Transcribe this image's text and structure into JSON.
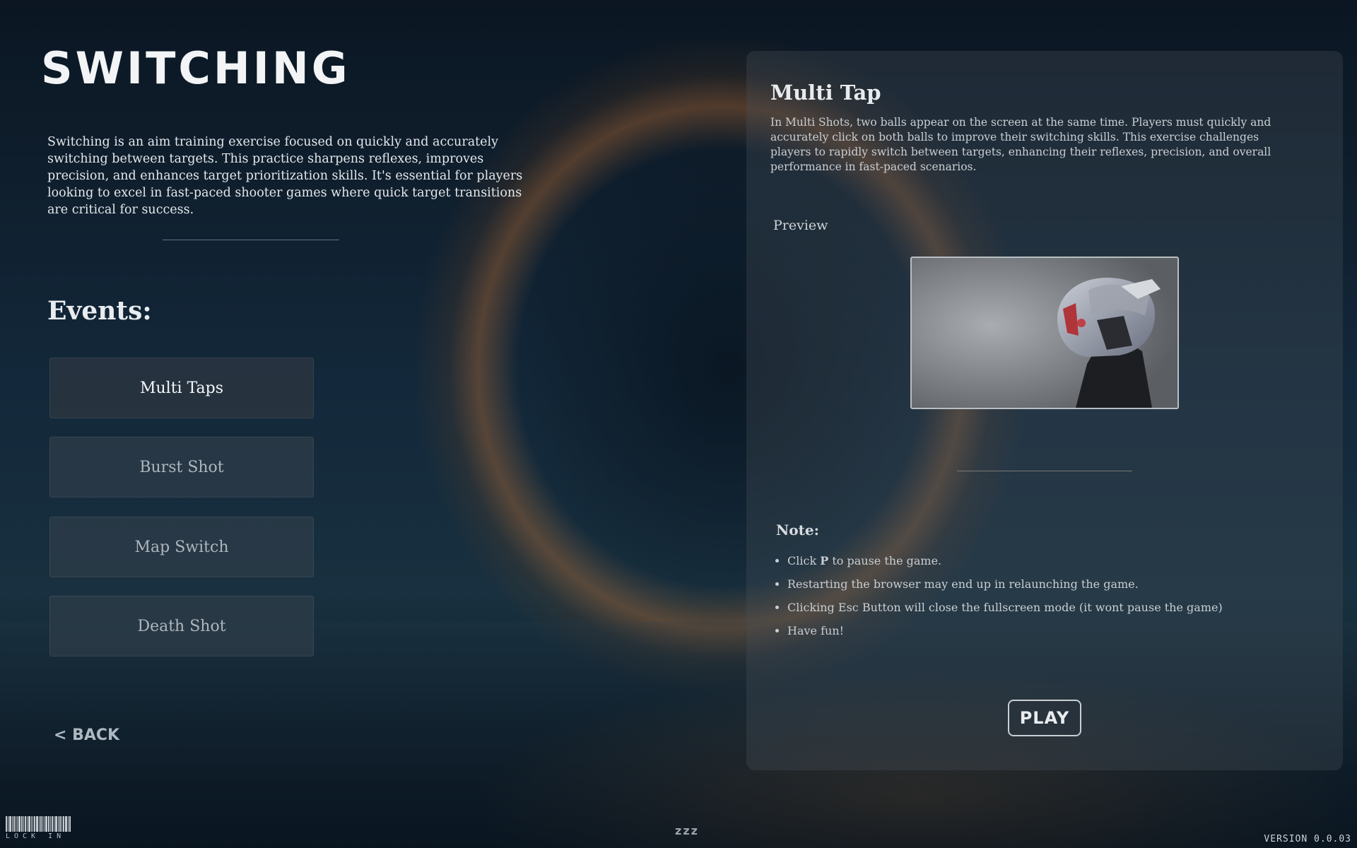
{
  "header": {
    "title": "SWITCHING",
    "intro": "Switching is an aim training exercise focused on quickly and accurately switching between targets. This practice sharpens reflexes, improves precision, and enhances target prioritization skills. It's essential for players looking to excel in fast-paced shooter games where quick target transitions are critical for success."
  },
  "events": {
    "heading": "Events:",
    "items": [
      {
        "label": "Multi Taps"
      },
      {
        "label": "Burst Shot"
      },
      {
        "label": "Map Switch"
      },
      {
        "label": "Death Shot"
      }
    ]
  },
  "back_label": "< BACK",
  "detail": {
    "title": "Multi Tap",
    "description": "In Multi Shots, two balls appear on the screen at the same time. Players must quickly and accurately click on both balls to improve their switching skills. This exercise challenges players to rapidly switch between targets, enhancing their reflexes, precision, and overall performance in fast-paced scenarios.",
    "preview_label": "Preview",
    "note_label": "Note:",
    "notes": [
      {
        "prefix": "Click ",
        "key": "P",
        "suffix": " to pause the game."
      },
      {
        "text": "Restarting the browser may end up in relaunching the game."
      },
      {
        "text": "Clicking Esc Button will close the fullscreen mode (it wont pause the game)"
      },
      {
        "text": "Have fun!"
      }
    ],
    "play_label": "PLAY"
  },
  "footer": {
    "logo_text": "LOCK IN",
    "center": "zzz",
    "version": "VERSION 0.0.03"
  },
  "colors": {
    "accent_text": "#e3e6ea",
    "panel_bg": "#46505a",
    "button_bg": "#37424c"
  }
}
